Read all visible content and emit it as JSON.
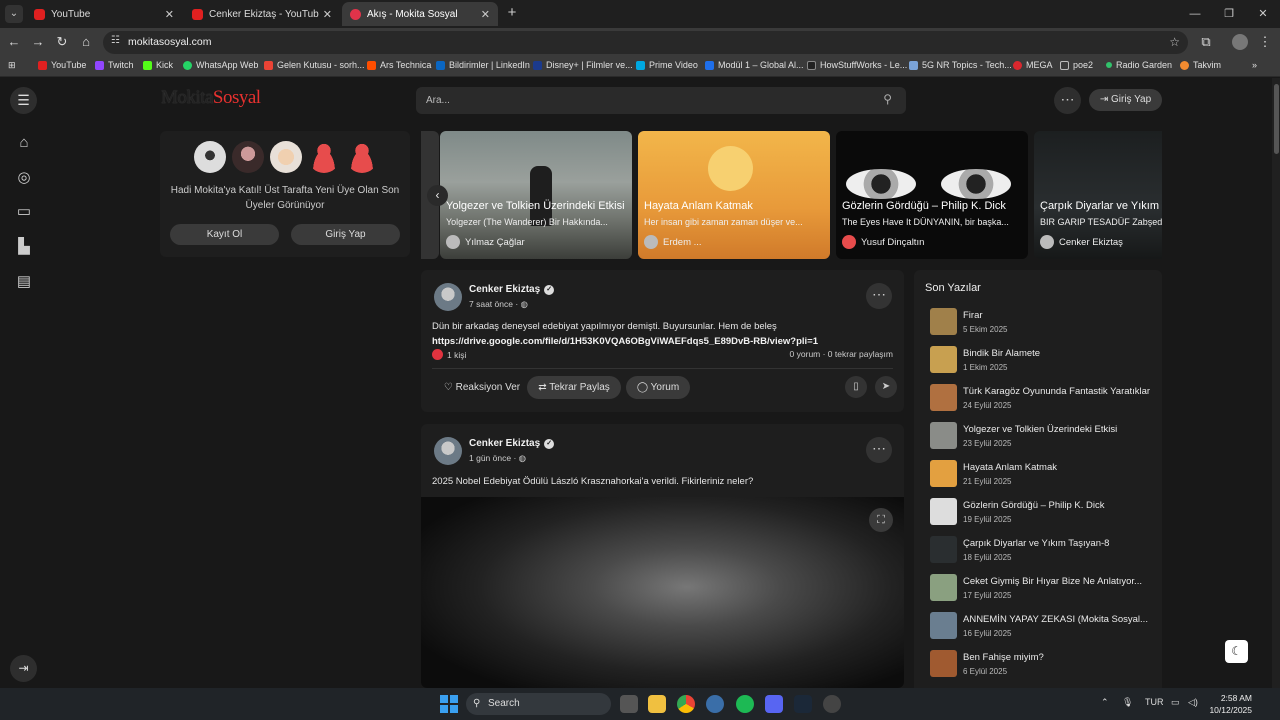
{
  "browser": {
    "tabs": [
      {
        "title": "YouTube",
        "favicon_color": "#e02020"
      },
      {
        "title": "Cenker Ekiztaş - YouTube",
        "favicon_color": "#e02020"
      },
      {
        "title": "Akış - Mokita Sosyal",
        "favicon_color": "#e0334a"
      }
    ],
    "url": "mokitasosyal.com",
    "bookmarks": [
      {
        "label": "YouTube",
        "color": "#e02020"
      },
      {
        "label": "Twitch",
        "color": "#9146ff"
      },
      {
        "label": "Kick",
        "color": "#53fc18"
      },
      {
        "label": "WhatsApp Web",
        "color": "#25d366"
      },
      {
        "label": "Gelen Kutusu - sorh...",
        "color": "#ea4335"
      },
      {
        "label": "Ars Technica",
        "color": "#ff4e00"
      },
      {
        "label": "Bildirimler | LinkedIn",
        "color": "#0a66c2"
      },
      {
        "label": "Disney+ | Filmler ve...",
        "color": "#1b3a8c"
      },
      {
        "label": "Prime Video",
        "color": "#00a8e1"
      },
      {
        "label": "Modül 1 – Global Al...",
        "color": "#1f6feb"
      },
      {
        "label": "HowStuffWorks - Le...",
        "color": "#222222"
      },
      {
        "label": "5G NR Topics - Tech...",
        "color": "#7aa3d8"
      },
      {
        "label": "MEGA",
        "color": "#d9272e"
      },
      {
        "label": "poe2",
        "color": "#8a8a8a"
      },
      {
        "label": "Radio Garden",
        "color": "#31c26b"
      },
      {
        "label": "Takvim",
        "color": "#f28b30"
      }
    ]
  },
  "site": {
    "logo_part1": "Mokita",
    "logo_part2": "Sosyal",
    "search_placeholder": "Ara...",
    "login_label": "Giriş Yap",
    "members": {
      "text": "Hadi Mokita'ya Katıl! Üst Tarafta Yeni Üye Olan Son Üyeler Görünüyor",
      "register_label": "Kayıt Ol",
      "login_label": "Giriş Yap"
    },
    "carousel": [
      {
        "title": "Yolgezer ve Tolkien Üzerindeki Etkisi",
        "subtitle": "Yolgezer (The Wanderer) Bir Hakkında...",
        "author": "Yılmaz Çağlar"
      },
      {
        "title": "Hayata Anlam Katmak",
        "subtitle": "Her insan gibi zaman zaman düşer ve...",
        "author": "Erdem ..."
      },
      {
        "title": "Gözlerin Gördüğü – Philip K. Dick",
        "subtitle": "The Eyes Have It DÜNYANIN, bir başka...",
        "author": "Yusuf Dinçaltın"
      },
      {
        "title": "Çarpık Diyarlar ve Yıkım Ta...",
        "subtitle": "BIR GARIP TESADÜF Zabşed İ...",
        "author": "Cenker Ekiztaş"
      }
    ],
    "posts": [
      {
        "author": "Cenker Ekiztaş",
        "time": "7 saat önce",
        "text": "Dün bir arkadaş deneysel edebiyat yapılmıyor demişti. Buyursunlar. Hem de beleş",
        "link": "https://drive.google.com/file/d/1H53K0VQA6OBgViWAEFdqs5_E89DvB-RB/view?pli=1",
        "likes": "1 kişi",
        "stats": "0 yorum · 0 tekrar paylaşım",
        "react_label": "Reaksiyon Ver",
        "share_label": "Tekrar Paylaş",
        "comment_label": "Yorum"
      },
      {
        "author": "Cenker Ekiztaş",
        "time": "1 gün önce",
        "text": "2025 Nobel Edebiyat Ödülü László Krasznahorkai'a verildi. Fikirleriniz neler?"
      }
    ],
    "latest": {
      "heading": "Son Yazılar",
      "items": [
        {
          "title": "Firar",
          "date": "5 Ekim 2025",
          "color": "#a0804a"
        },
        {
          "title": "Bindik Bir Alamete",
          "date": "1 Ekim 2025",
          "color": "#c8a050"
        },
        {
          "title": "Türk Karagöz Oyununda Fantastik Yaratıklar",
          "date": "24 Eylül 2025",
          "color": "#b07040"
        },
        {
          "title": "Yolgezer ve Tolkien Üzerindeki Etkisi",
          "date": "23 Eylül 2025",
          "color": "#8a8c88"
        },
        {
          "title": "Hayata Anlam Katmak",
          "date": "21 Eylül 2025",
          "color": "#e3a040"
        },
        {
          "title": "Gözlerin Gördüğü – Philip K. Dick",
          "date": "19 Eylül 2025",
          "color": "#dddddd"
        },
        {
          "title": "Çarpık Diyarlar ve Yıkım Taşıyan-8",
          "date": "18 Eylül 2025",
          "color": "#2a2e30"
        },
        {
          "title": "Ceket Giymiş Bir Hıyar Bize Ne Anlatıyor...",
          "date": "17 Eylül 2025",
          "color": "#8aa080"
        },
        {
          "title": "ANNEMİN YAPAY ZEKASI (Mokita Sosyal...",
          "date": "16 Eylül 2025",
          "color": "#6a7e90"
        },
        {
          "title": "Ben Fahişe miyim?",
          "date": "6 Eylül 2025",
          "color": "#a05a30"
        }
      ]
    }
  },
  "taskbar": {
    "search_label": "Search",
    "lang": "TUR",
    "time": "2:58 AM",
    "date": "10/12/2025"
  }
}
